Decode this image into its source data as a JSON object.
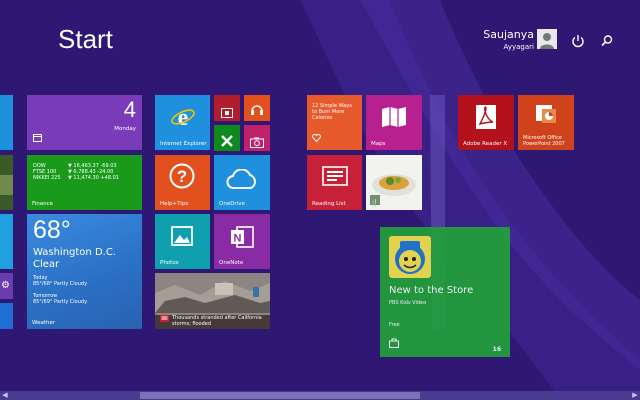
{
  "header": {
    "title": "Start",
    "user_first_name": "Saujanya",
    "user_last_name": "Ayyagari"
  },
  "tiles": {
    "calendar": {
      "day_number": "4",
      "weekday": "Monday"
    },
    "finance": {
      "rows": [
        {
          "index": "DOW",
          "value": "▼ 16,463.37 -69.03"
        },
        {
          "index": "FTSE 100",
          "value": "▼ 6,788.43 -24.00"
        },
        {
          "index": "NIKKEI 225",
          "value": "▼ 11,474.30 +48.01"
        }
      ],
      "label": "Finance"
    },
    "weather": {
      "temperature": "68°",
      "location": "Washington D.C.",
      "condition": "Clear",
      "today_label": "Today",
      "today_forecast": "85°/68° Partly Cloudy",
      "tomorrow_label": "Tomorrow",
      "tomorrow_forecast": "85°/69° Partly Cloudy",
      "label": "Weather"
    },
    "internet_explorer": {
      "label": "Internet Explorer"
    },
    "help_tips": {
      "label": "Help+Tips"
    },
    "onedrive": {
      "label": "OneDrive"
    },
    "photos": {
      "label": "Photos"
    },
    "onenote": {
      "label": "OneNote"
    },
    "news": {
      "headline": "Thousands stranded after California storms; flooded"
    },
    "health": {
      "text": "12 Simple Ways to Burn More Calories"
    },
    "maps": {
      "label": "Maps"
    },
    "reading_list": {
      "label": "Reading List"
    },
    "adobe_reader": {
      "label": "Adobe Reader X"
    },
    "office_ppt": {
      "label": "Microsoft Office PowerPoint 2007"
    },
    "store": {
      "title": "New to the Store",
      "subtitle": "PBS Kids Video",
      "price": "Free",
      "count": "16"
    }
  },
  "colors": {
    "background": "#2e1873",
    "calendar": "#7a3bb8",
    "finance": "#199a1b",
    "weather": "#2a7ad1",
    "ie": "#1e90de",
    "small_red": "#b01e2e",
    "small_green": "#0c8a1c",
    "small_pink": "#c0216d",
    "help": "#e2511d",
    "onedrive": "#1e90de",
    "photos": "#0f9faf",
    "onenote": "#8a2ba6",
    "health": "#e65a2c",
    "maps": "#b6208f",
    "reading_list": "#c7213a",
    "adobe": "#b3121c",
    "office": "#d0421b",
    "store": "#23a03b"
  }
}
